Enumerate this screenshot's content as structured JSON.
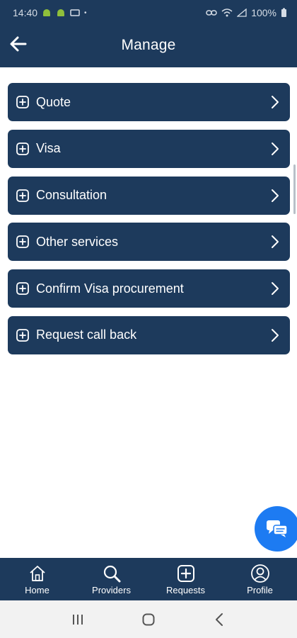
{
  "status_bar": {
    "time": "14:40",
    "battery": "100%"
  },
  "header": {
    "title": "Manage"
  },
  "menu": {
    "items": [
      {
        "label": "Quote",
        "icon": "plus-square-icon"
      },
      {
        "label": "Visa",
        "icon": "plus-square-icon"
      },
      {
        "label": "Consultation",
        "icon": "plus-square-icon"
      },
      {
        "label": "Other services",
        "icon": "plus-square-icon"
      },
      {
        "label": "Confirm Visa procurement",
        "icon": "plus-square-icon"
      },
      {
        "label": "Request call back",
        "icon": "plus-square-icon"
      }
    ]
  },
  "bottom_nav": {
    "items": [
      {
        "label": "Home",
        "icon": "home-icon"
      },
      {
        "label": "Providers",
        "icon": "search-icon"
      },
      {
        "label": "Requests",
        "icon": "plus-square-icon"
      },
      {
        "label": "Profile",
        "icon": "user-icon"
      }
    ]
  },
  "colors": {
    "primary": "#1d3a5c",
    "fab": "#1d7bf2",
    "background": "#ffffff"
  }
}
